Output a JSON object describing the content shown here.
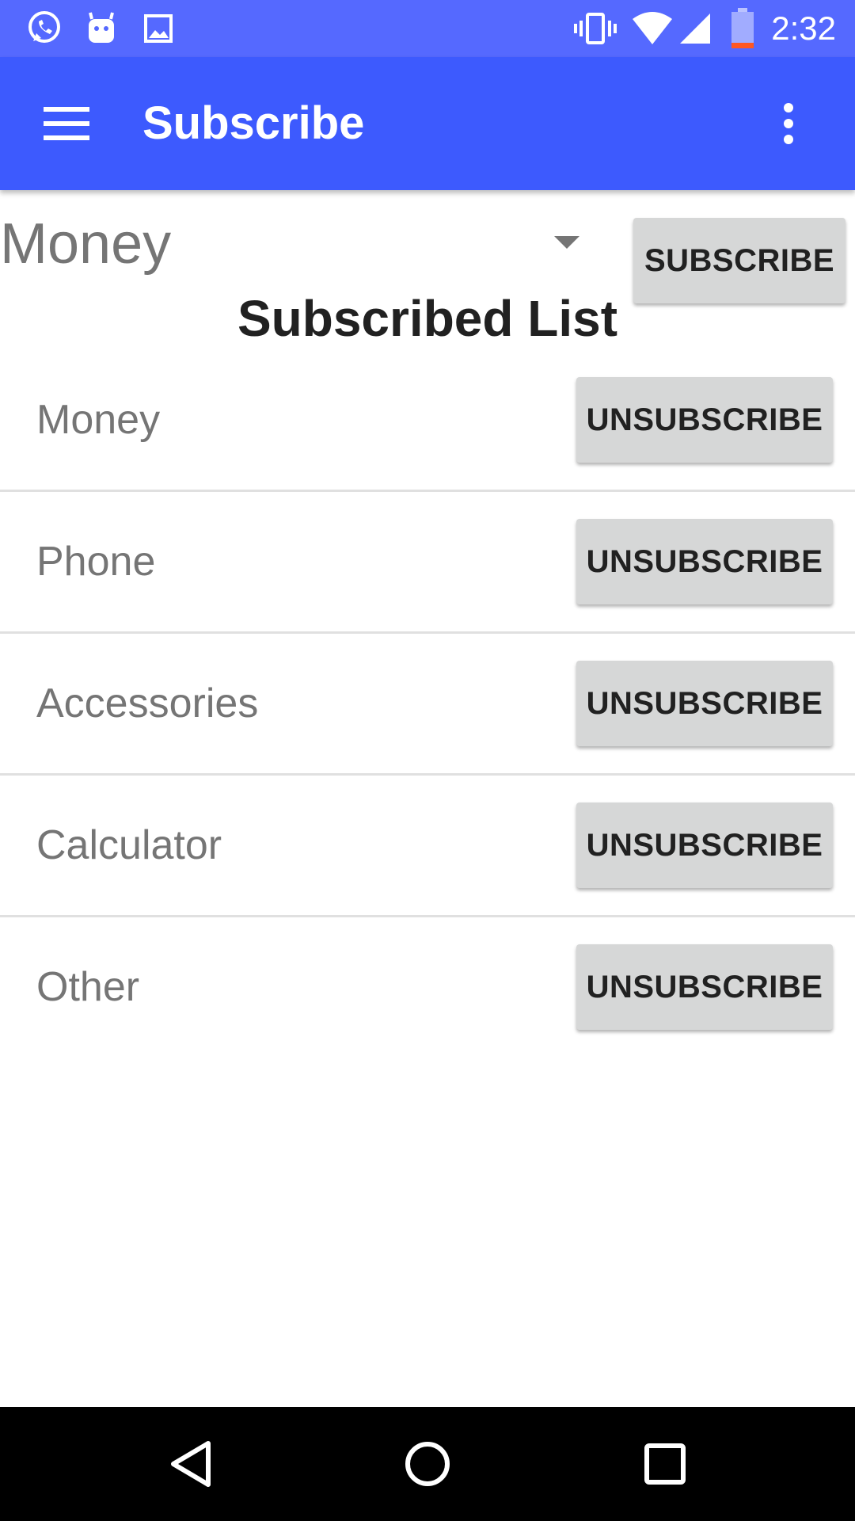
{
  "status_bar": {
    "time": "2:32",
    "left_icons": [
      "whatsapp-icon",
      "android-icon",
      "image-icon"
    ],
    "right_icons": [
      "vibrate-icon",
      "wifi-icon",
      "signal-icon",
      "battery-low-icon"
    ]
  },
  "app_bar": {
    "title": "Subscribe",
    "menu_icon": "hamburger-menu-icon",
    "overflow_icon": "more-vert-icon"
  },
  "subscribe_form": {
    "selected_topic": "Money",
    "subscribe_label": "SUBSCRIBE"
  },
  "subscribed_list": {
    "title": "Subscribed List",
    "items": [
      {
        "label": "Money",
        "action": "UNSUBSCRIBE"
      },
      {
        "label": "Phone",
        "action": "UNSUBSCRIBE"
      },
      {
        "label": "Accessories",
        "action": "UNSUBSCRIBE"
      },
      {
        "label": "Calculator",
        "action": "UNSUBSCRIBE"
      },
      {
        "label": "Other",
        "action": "UNSUBSCRIBE"
      }
    ]
  },
  "nav_bar": {
    "back_icon": "back-triangle-icon",
    "home_icon": "home-circle-icon",
    "recents_icon": "recents-square-icon"
  },
  "colors": {
    "status_bar": "#5569ff",
    "app_bar": "#3d5afe",
    "button_bg": "#d6d7d7"
  }
}
